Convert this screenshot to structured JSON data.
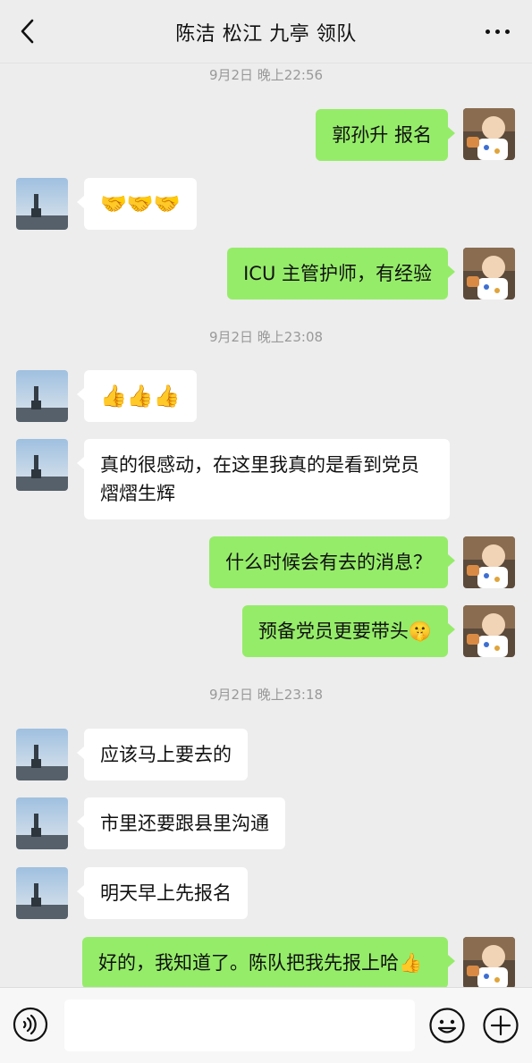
{
  "header": {
    "title": "陈洁 松江 九亭 领队"
  },
  "messages": [
    {
      "kind": "time",
      "text": "9月2日 晚上22:56"
    },
    {
      "kind": "out",
      "text": "郭孙升 报名"
    },
    {
      "kind": "in",
      "text": "🤝🤝🤝"
    },
    {
      "kind": "out",
      "text": "ICU 主管护师，有经验"
    },
    {
      "kind": "time",
      "text": "9月2日 晚上23:08"
    },
    {
      "kind": "in",
      "text": "👍👍👍"
    },
    {
      "kind": "in",
      "text": "真的很感动，在这里我真的是看到党员熠熠生辉"
    },
    {
      "kind": "out",
      "text": "什么时候会有去的消息？"
    },
    {
      "kind": "out",
      "text": "预备党员更要带头🤫"
    },
    {
      "kind": "time",
      "text": "9月2日 晚上23:18"
    },
    {
      "kind": "in",
      "text": "应该马上要去的"
    },
    {
      "kind": "in",
      "text": "市里还要跟县里沟通"
    },
    {
      "kind": "in",
      "text": "明天早上先报名"
    },
    {
      "kind": "out",
      "text": "好的，我知道了。陈队把我先报上哈👍"
    }
  ],
  "icons": {
    "back": "back-chevron-icon",
    "more": "more-dots-icon",
    "voice": "voice-input-icon",
    "emoji": "emoji-face-icon",
    "plus": "plus-icon"
  },
  "colors": {
    "background": "#ededed",
    "outgoing_bubble": "#95ec69",
    "incoming_bubble": "#ffffff",
    "timestamp": "#999999"
  }
}
